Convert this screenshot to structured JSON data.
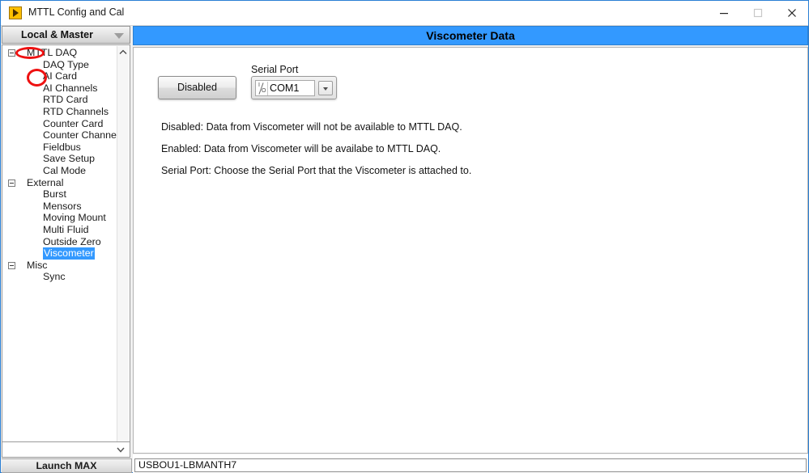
{
  "window": {
    "title": "MTTL Config and Cal",
    "app_icon": "play-triangle-icon",
    "controls": {
      "minimize": "minimize-icon",
      "maximize": "maximize-icon",
      "close": "close-icon"
    }
  },
  "sidebar": {
    "header": {
      "label": "Local & Master",
      "arrow": "chevron-down-icon"
    },
    "tree": [
      {
        "label": "MTTL DAQ",
        "level": 0,
        "expander": true,
        "selected": false
      },
      {
        "label": "DAQ Type",
        "level": 1,
        "expander": false,
        "selected": false
      },
      {
        "label": "AI Card",
        "level": 1,
        "expander": false,
        "selected": false
      },
      {
        "label": "AI Channels",
        "level": 1,
        "expander": false,
        "selected": false
      },
      {
        "label": "RTD Card",
        "level": 1,
        "expander": false,
        "selected": false
      },
      {
        "label": "RTD Channels",
        "level": 1,
        "expander": false,
        "selected": false
      },
      {
        "label": "Counter Card",
        "level": 1,
        "expander": false,
        "selected": false
      },
      {
        "label": "Counter Channels",
        "level": 1,
        "expander": false,
        "selected": false
      },
      {
        "label": "Fieldbus",
        "level": 1,
        "expander": false,
        "selected": false
      },
      {
        "label": "Save Setup",
        "level": 1,
        "expander": false,
        "selected": false
      },
      {
        "label": "Cal Mode",
        "level": 1,
        "expander": false,
        "selected": false
      },
      {
        "label": "External",
        "level": 0,
        "expander": true,
        "selected": false
      },
      {
        "label": "Burst",
        "level": 1,
        "expander": false,
        "selected": false
      },
      {
        "label": "Mensors",
        "level": 1,
        "expander": false,
        "selected": false
      },
      {
        "label": "Moving Mount",
        "level": 1,
        "expander": false,
        "selected": false
      },
      {
        "label": "Multi Fluid",
        "level": 1,
        "expander": false,
        "selected": false
      },
      {
        "label": "Outside Zero",
        "level": 1,
        "expander": false,
        "selected": false
      },
      {
        "label": "Viscometer",
        "level": 1,
        "expander": false,
        "selected": true
      },
      {
        "label": "Misc",
        "level": 0,
        "expander": true,
        "selected": false
      },
      {
        "label": "Sync",
        "level": 1,
        "expander": false,
        "selected": false
      }
    ],
    "scrollbar": {
      "up_arrow": "chevron-up-icon",
      "down_arrow": "chevron-down-icon"
    },
    "bottom_combo": {
      "value": "",
      "arrow": "chevron-down-icon"
    },
    "launch_max_label": "Launch MAX"
  },
  "banner": {
    "title": "Viscometer Data"
  },
  "main": {
    "toggle_button": {
      "label": "Disabled",
      "state": "disabled"
    },
    "serial_port": {
      "label": "Serial Port",
      "value": "COM1",
      "icon": "visa-resource-icon",
      "dropdown_arrow": "chevron-down-icon"
    },
    "help_lines": [
      "Disabled: Data from Viscometer will not be available to MTTL DAQ.",
      "Enabled: Data from Viscometer will be availabe to MTTL DAQ.",
      "Serial Port: Choose the Serial Port that the Viscometer is attached to."
    ]
  },
  "status_bar": {
    "value": "USBOU1-LBMANTH7"
  },
  "annotations": [
    {
      "name": "annotation-ellipse-mttl-daq-expander",
      "shape": "ellipse",
      "color": "#ee1111"
    },
    {
      "name": "annotation-ellipse-ai-card",
      "shape": "circle",
      "color": "#ee1111"
    }
  ],
  "colors": {
    "banner_blue": "#3399ff",
    "selection_blue": "#3399ff",
    "annotation_red": "#ee1111",
    "window_border": "#2a7fd4"
  }
}
